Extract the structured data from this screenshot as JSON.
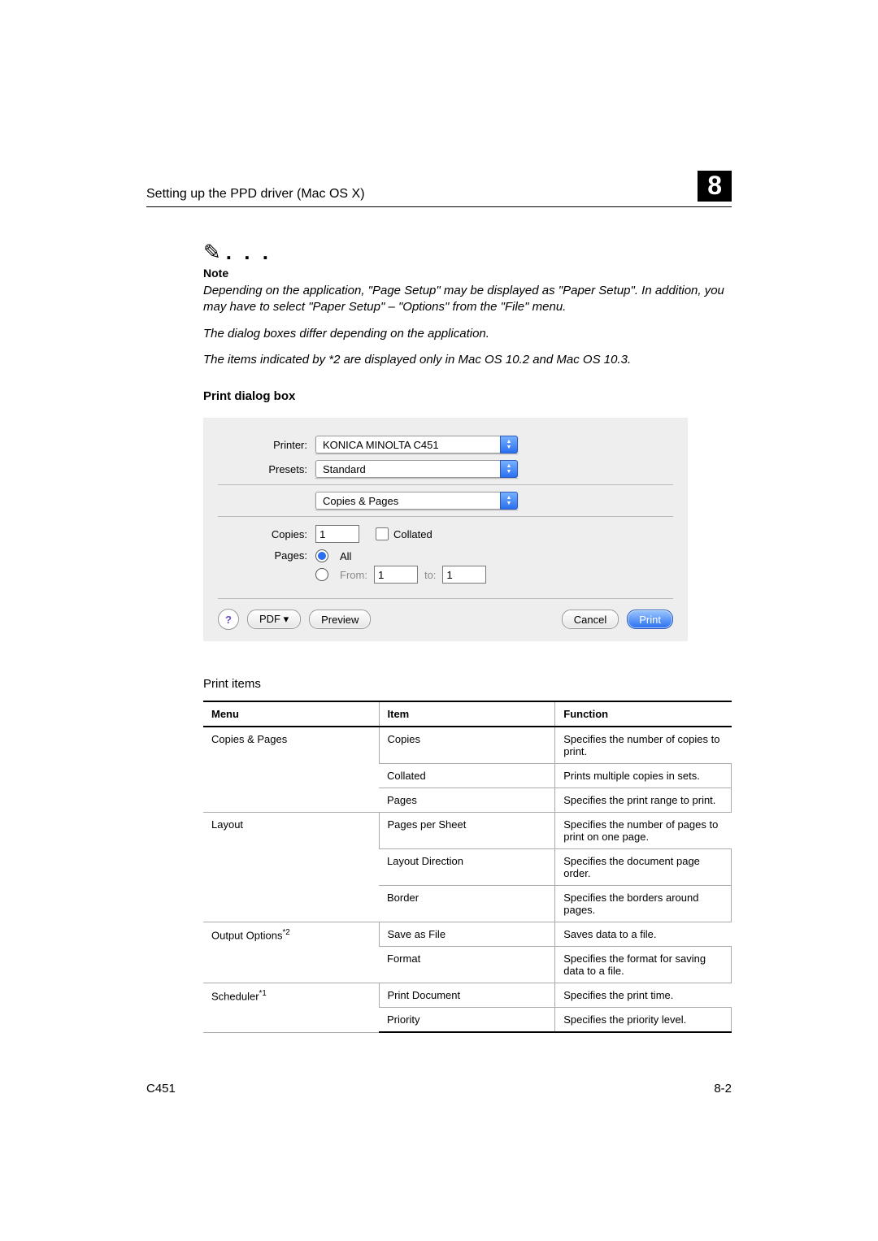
{
  "header": {
    "title": "Setting up the PPD driver (Mac OS X)",
    "chapter": "8"
  },
  "note": {
    "icon_dots": ". . .",
    "label": "Note",
    "paragraphs": [
      "Depending on the application, \"Page Setup\" may be displayed as \"Paper Setup\". In addition, you may have to select \"Paper Setup\" – \"Options\" from the \"File\" menu.",
      "The dialog boxes differ depending on the application.",
      "The items indicated by *2 are displayed only in Mac OS 10.2 and Mac OS 10.3."
    ]
  },
  "section_heading": "Print dialog box",
  "dialog": {
    "labels": {
      "printer": "Printer:",
      "presets": "Presets:",
      "copies": "Copies:",
      "pages": "Pages:",
      "from": "From:",
      "to": "to:"
    },
    "printer_value": "KONICA MINOLTA C451",
    "preset_value": "Standard",
    "panel_value": "Copies & Pages",
    "copies_value": "1",
    "collated_label": "Collated",
    "all_label": "All",
    "from_value": "1",
    "to_value": "1",
    "buttons": {
      "help": "?",
      "pdf": "PDF ▾",
      "preview": "Preview",
      "cancel": "Cancel",
      "print": "Print"
    }
  },
  "caption": "Print items",
  "table": {
    "headers": [
      "Menu",
      "Item",
      "Function"
    ],
    "groups": [
      {
        "menu": "Copies & Pages",
        "rows": [
          {
            "item": "Copies",
            "fn": "Specifies the number of copies to print."
          },
          {
            "item": "Collated",
            "fn": "Prints multiple copies in sets."
          },
          {
            "item": "Pages",
            "fn": "Specifies the print range to print."
          }
        ]
      },
      {
        "menu": "Layout",
        "rows": [
          {
            "item": "Pages per Sheet",
            "fn": "Specifies the number of pages to print on one page."
          },
          {
            "item": "Layout Direction",
            "fn": "Specifies the document page order."
          },
          {
            "item": "Border",
            "fn": "Specifies the borders around pages."
          }
        ]
      },
      {
        "menu": "Output Options",
        "menu_sup": "*2",
        "rows": [
          {
            "item": "Save as File",
            "fn": "Saves data to a file."
          },
          {
            "item": "Format",
            "fn": "Specifies the format for saving data to a file."
          }
        ]
      },
      {
        "menu": "Scheduler",
        "menu_sup": "*1",
        "rows": [
          {
            "item": "Print Document",
            "fn": "Specifies the print time."
          },
          {
            "item": "Priority",
            "fn": "Specifies the priority level."
          }
        ]
      }
    ]
  },
  "footer": {
    "left": "C451",
    "right": "8-2"
  }
}
